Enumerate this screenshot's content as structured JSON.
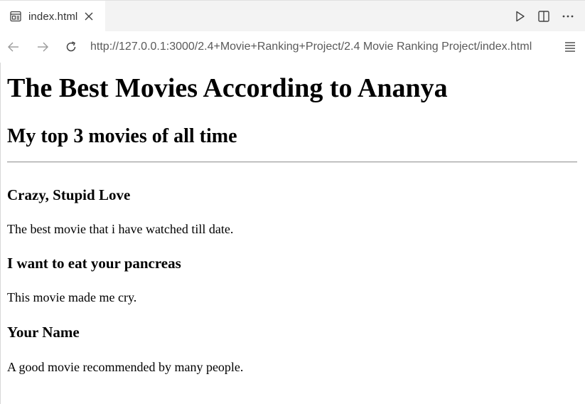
{
  "tab": {
    "title": "index.html"
  },
  "address": {
    "url": "http://127.0.0.1:3000/2.4+Movie+Ranking+Project/2.4 Movie Ranking Project/index.html"
  },
  "page": {
    "heading": "The Best Movies According to Ananya",
    "subheading": "My top 3 movies of all time",
    "movies": [
      {
        "title": "Crazy, Stupid Love",
        "description": "The best movie that i have watched till date."
      },
      {
        "title": "I want to eat your pancreas",
        "description": "This movie made me cry."
      },
      {
        "title": "Your Name",
        "description": "A good movie recommended by many people."
      }
    ]
  },
  "icons": {
    "tab_file": "preview-file-icon",
    "tab_close": "close-icon",
    "run": "play-icon",
    "split": "split-editor-icon",
    "more": "more-icon",
    "back": "arrow-left-icon",
    "forward": "arrow-right-icon",
    "reload": "reload-icon",
    "menu": "menu-icon"
  },
  "colors": {
    "tabbar_bg": "#f3f3f3",
    "url_text": "#5a5a5a",
    "nav_disabled": "#9a9a9a",
    "nav_enabled": "#444444"
  }
}
